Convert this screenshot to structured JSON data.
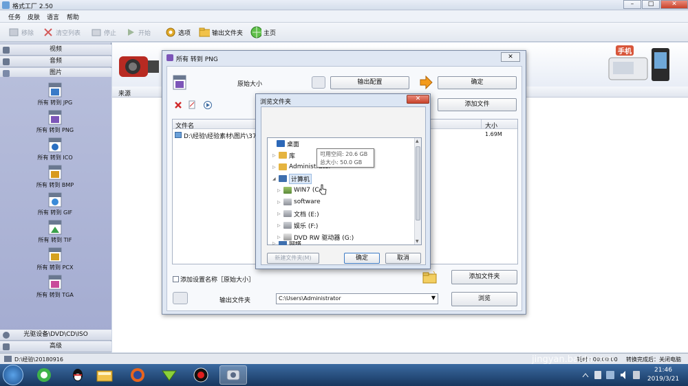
{
  "app": {
    "title": "格式工厂 2.50",
    "colors": {
      "accent": "#2f5f9e",
      "toolbar": "#e3e8f0",
      "sidebar": "#aab2d4",
      "close": "#c8432b"
    }
  },
  "menu": [
    "任务",
    "皮肤",
    "语言",
    "帮助"
  ],
  "toolbar": {
    "remove": "移除",
    "clear": "清空列表",
    "stop": "停止",
    "start": "开始",
    "options": "选项",
    "output_folder": "输出文件夹",
    "home": "主页"
  },
  "sidebar": {
    "sections": {
      "video": "视频",
      "audio": "音频",
      "image": "图片",
      "rom": "光驱设备\\DVD\\CD\\ISO",
      "advanced": "高级"
    },
    "formats": [
      {
        "tag": "JPG",
        "label": "所有 转到 JPG",
        "color": "#3a7bc8"
      },
      {
        "tag": "PNG",
        "label": "所有 转到 PNG",
        "color": "#7c55b8"
      },
      {
        "tag": "ICO",
        "label": "所有 转到 ICO",
        "color": "#2a6fc2"
      },
      {
        "tag": "BMP",
        "label": "所有 转到 BMP",
        "color": "#d89a1c"
      },
      {
        "tag": "ICO",
        "label": "所有 转到 GIF",
        "color": "#3b8bd8"
      },
      {
        "tag": "TIFF",
        "label": "所有 转到 TIF",
        "color": "#3aa04a"
      },
      {
        "tag": "PCX",
        "label": "所有 转到 PCX",
        "color": "#d6a21e"
      },
      {
        "tag": "TGA",
        "label": "所有 转到 TGA",
        "color": "#c94a9a"
      }
    ]
  },
  "main": {
    "source_col": "来源",
    "banner_text": "手机"
  },
  "convert_dialog": {
    "title": "所有 转到 PNG",
    "icon_tag": "PNG",
    "size_label": "原始大小",
    "output_settings": "输出配置",
    "ok": "确定",
    "add_file": "添加文件",
    "col_filename": "文件名",
    "col_size": "大小",
    "file_path": "D:\\经验\\经验素材\\图片\\370",
    "file_size": "1.69M",
    "add_setting_name": "添加设置名称［原始大小］",
    "add_folder": "添加文件夹",
    "output_folder_label": "输出文件夹",
    "output_path": "C:\\Users\\Administrator",
    "browse": "浏览"
  },
  "browse_dialog": {
    "title": "浏览文件夹",
    "tree": [
      {
        "label": "桌面",
        "icon": "desktop-icon",
        "level": 0,
        "arrow": ""
      },
      {
        "label": "库",
        "icon": "library-icon",
        "level": 1,
        "arrow": "▷"
      },
      {
        "label": "Administrator",
        "icon": "user-folder-icon",
        "level": 1,
        "arrow": "▷"
      },
      {
        "label": "计算机",
        "icon": "computer-icon",
        "level": 1,
        "arrow": "◢",
        "selected": true
      },
      {
        "label": "WIN7 (C:)",
        "icon": "drive-icon",
        "level": 2,
        "arrow": "▷"
      },
      {
        "label": "software",
        "icon": "drive-icon",
        "level": 2,
        "arrow": "▷"
      },
      {
        "label": "文档 (E:)",
        "icon": "drive-icon",
        "level": 2,
        "arrow": "▷"
      },
      {
        "label": "娱乐 (F:)",
        "icon": "drive-icon",
        "level": 2,
        "arrow": "▷"
      },
      {
        "label": "DVD RW 驱动器 (G:)",
        "icon": "dvd-drive-icon",
        "level": 2,
        "arrow": "▷"
      },
      {
        "label": "网络",
        "icon": "network-icon",
        "level": 1,
        "arrow": "▷"
      }
    ],
    "tooltip": {
      "free": "可用空间: 20.6 GB",
      "total": "总大小: 50.0 GB"
    },
    "new_folder": "新建文件夹(M)",
    "ok": "确定",
    "cancel": "取消"
  },
  "statusbar": {
    "path": "D:\\经验\\20180916",
    "elapsed": "耗时 : 00:00:00",
    "after_done": "转换完成后：关闭电脑"
  },
  "taskbar": {
    "time": "21:46",
    "date": "2019/3/21"
  },
  "watermark": {
    "brand": "Bai",
    "brand2": "du",
    "cn": "经验",
    "url": "jingyan.baidu.com"
  }
}
